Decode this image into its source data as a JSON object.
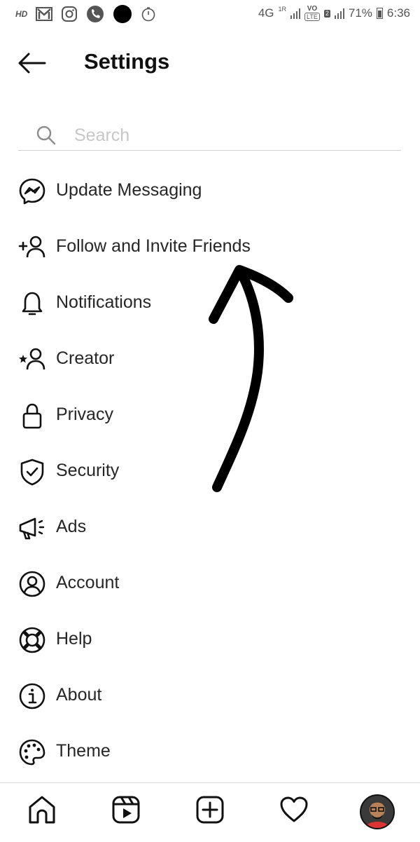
{
  "status_bar": {
    "hd": "HD",
    "network": "4G",
    "sim1": "1R",
    "volte": "VO",
    "lte": "LTE",
    "sim2": "2",
    "battery": "71%",
    "time": "6:36"
  },
  "header": {
    "title": "Settings",
    "back_icon": "arrow-left-icon"
  },
  "search": {
    "placeholder": "Search",
    "value": ""
  },
  "menu": [
    {
      "label": "Update Messaging",
      "icon": "messenger-icon"
    },
    {
      "label": "Follow and Invite Friends",
      "icon": "add-person-icon"
    },
    {
      "label": "Notifications",
      "icon": "bell-icon"
    },
    {
      "label": "Creator",
      "icon": "star-person-icon"
    },
    {
      "label": "Privacy",
      "icon": "lock-icon"
    },
    {
      "label": "Security",
      "icon": "shield-check-icon"
    },
    {
      "label": "Ads",
      "icon": "megaphone-icon"
    },
    {
      "label": "Account",
      "icon": "account-circle-icon"
    },
    {
      "label": "Help",
      "icon": "lifebuoy-icon"
    },
    {
      "label": "About",
      "icon": "info-icon"
    },
    {
      "label": "Theme",
      "icon": "palette-icon"
    }
  ],
  "bottom_nav": [
    {
      "icon": "home-icon"
    },
    {
      "icon": "reels-icon"
    },
    {
      "icon": "create-post-icon"
    },
    {
      "icon": "heart-icon"
    },
    {
      "icon": "profile-avatar"
    }
  ]
}
